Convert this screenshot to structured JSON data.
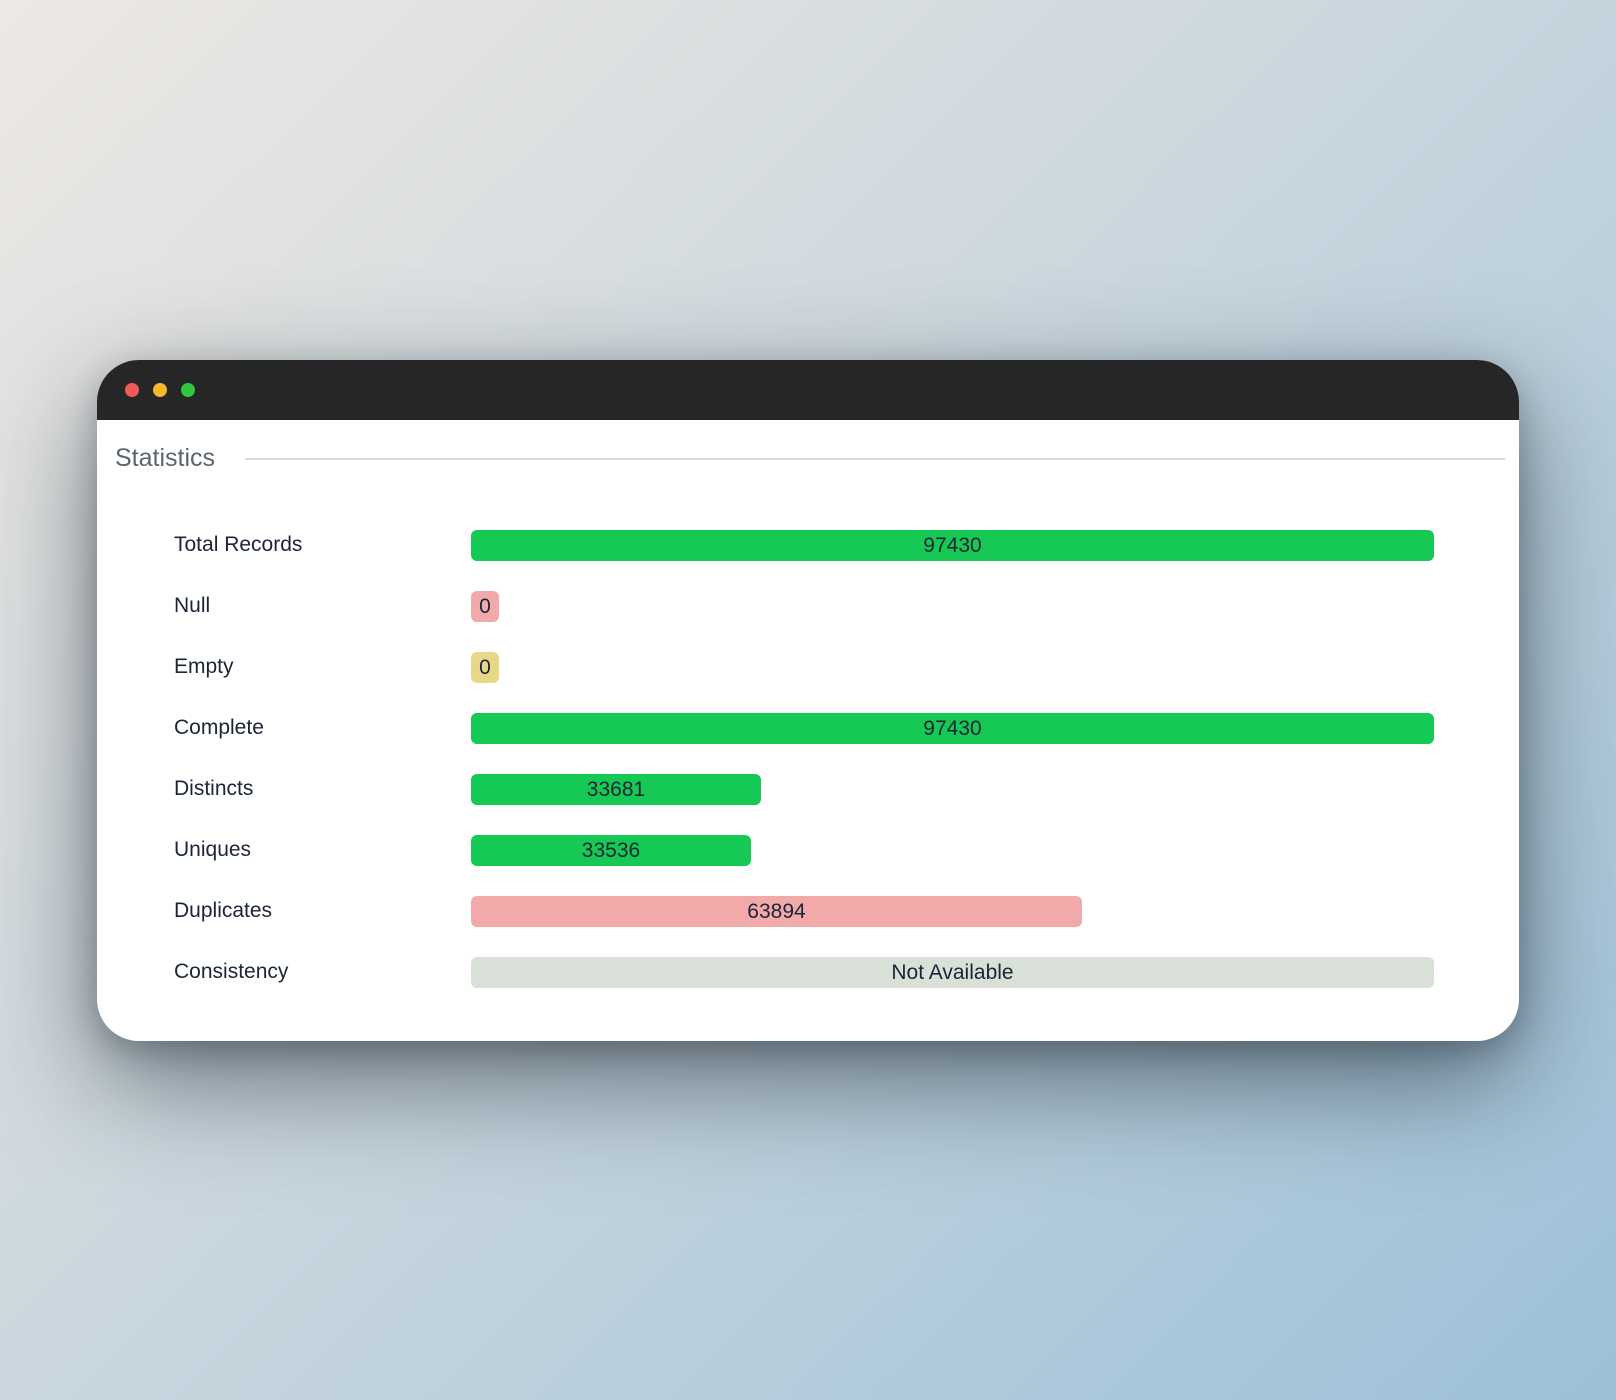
{
  "window": {
    "controls": {
      "close_color": "#f05a57",
      "minimize_color": "#f5b82e",
      "maximize_color": "#2fc840"
    }
  },
  "section": {
    "title": "Statistics"
  },
  "colors": {
    "success": "#16c955",
    "danger": "#f2a9aa",
    "warning": "#e8d788",
    "neutral": "#d8e0d8"
  },
  "stats": {
    "max": 97430,
    "rows": [
      {
        "label": "Total Records",
        "value": "97430",
        "fraction": 1.0,
        "color": "success"
      },
      {
        "label": "Null",
        "value": "0",
        "fraction": 0,
        "color": "danger"
      },
      {
        "label": "Empty",
        "value": "0",
        "fraction": 0,
        "color": "warning"
      },
      {
        "label": "Complete",
        "value": "97430",
        "fraction": 1.0,
        "color": "success"
      },
      {
        "label": "Distincts",
        "value": "33681",
        "fraction": 0.3012,
        "color": "success"
      },
      {
        "label": "Uniques",
        "value": "33536",
        "fraction": 0.2906,
        "color": "success"
      },
      {
        "label": "Duplicates",
        "value": "63894",
        "fraction": 0.6348,
        "color": "danger"
      },
      {
        "label": "Consistency",
        "value": "Not Available",
        "fraction": 1.0,
        "color": "neutral"
      }
    ]
  }
}
